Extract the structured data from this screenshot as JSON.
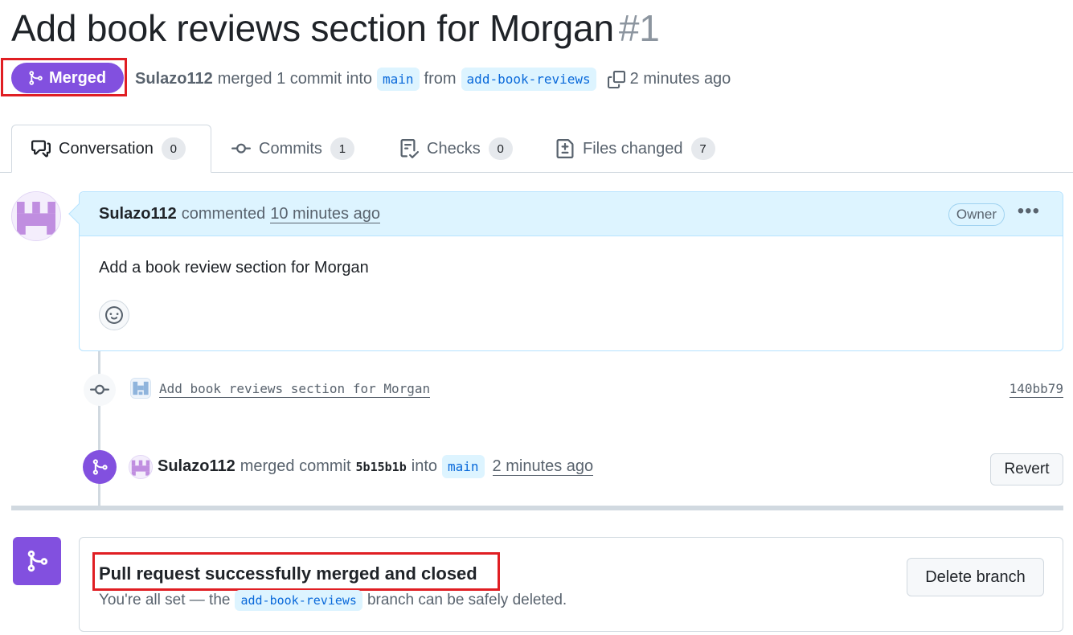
{
  "pr": {
    "title": "Add book reviews section for Morgan",
    "number": "#1",
    "state_label": "Merged",
    "author": "Sulazo112",
    "merge_phrase": "merged 1 commit into",
    "base_branch": "main",
    "from_word": "from",
    "head_branch": "add-book-reviews",
    "merged_ago": "2 minutes ago"
  },
  "tabs": [
    {
      "label": "Conversation",
      "count": "0",
      "icon": "comment-discussion-icon"
    },
    {
      "label": "Commits",
      "count": "1",
      "icon": "git-commit-icon"
    },
    {
      "label": "Checks",
      "count": "0",
      "icon": "checklist-icon"
    },
    {
      "label": "Files changed",
      "count": "7",
      "icon": "file-diff-icon"
    }
  ],
  "comment": {
    "author": "Sulazo112",
    "action": "commented",
    "time": "10 minutes ago",
    "badge": "Owner",
    "menu": "•••",
    "body": "Add a book review section for Morgan"
  },
  "commit": {
    "message": "Add book reviews section for Morgan",
    "sha": "140bb79"
  },
  "merge_event": {
    "author": "Sulazo112",
    "action": "merged commit",
    "sha": "5b15b1b",
    "into": "into",
    "branch": "main",
    "time": "2 minutes ago",
    "revert_label": "Revert"
  },
  "status": {
    "title": "Pull request successfully merged and closed",
    "sub_before": "You're all set — the",
    "branch": "add-book-reviews",
    "sub_after": "branch can be safely deleted.",
    "delete_label": "Delete branch"
  },
  "colors": {
    "merged_purple": "#8250df",
    "highlight_red": "#e01e23",
    "link_blue": "#0969da",
    "comment_header_bg": "#ddf4ff"
  }
}
